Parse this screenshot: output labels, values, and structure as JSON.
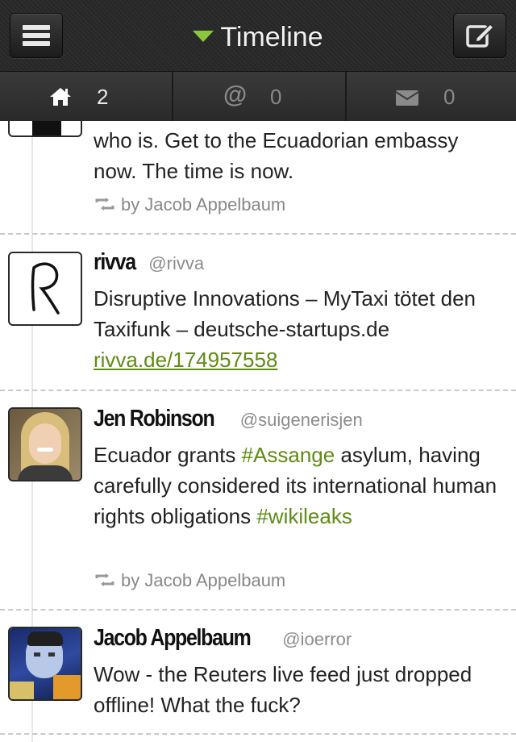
{
  "nav": {
    "title": "Timeline",
    "accent": "#8cc63e"
  },
  "tabs": [
    {
      "icon": "home-icon",
      "count": "2",
      "active": true
    },
    {
      "icon": "mention-icon",
      "count": "0",
      "active": false
    },
    {
      "icon": "mail-icon",
      "count": "0",
      "active": false
    }
  ],
  "tweets": [
    {
      "text": "who is. Get to the Ecuadorian embassy now. The time is now.",
      "retweet": "by Jacob Appelbaum"
    },
    {
      "name": "rivva",
      "handle": "@rivva",
      "text": "Disruptive Innovations – MyTaxi tötet den Taxifunk – deutsche-startups.de",
      "link": "rivva.de/174957558"
    },
    {
      "name": "Jen Robinson",
      "handle": "@suigenerisjen",
      "text_a": "Ecuador grants ",
      "hashtag_a": "#Assange",
      "text_b": " asylum, having carefully considered its international human rights obligations ",
      "hashtag_b": "#wikileaks",
      "retweet": "by Jacob Appelbaum"
    },
    {
      "name": "Jacob Appelbaum",
      "handle": "@ioerror",
      "text": "Wow - the Reuters live feed just dropped offline! What the fuck?"
    }
  ]
}
